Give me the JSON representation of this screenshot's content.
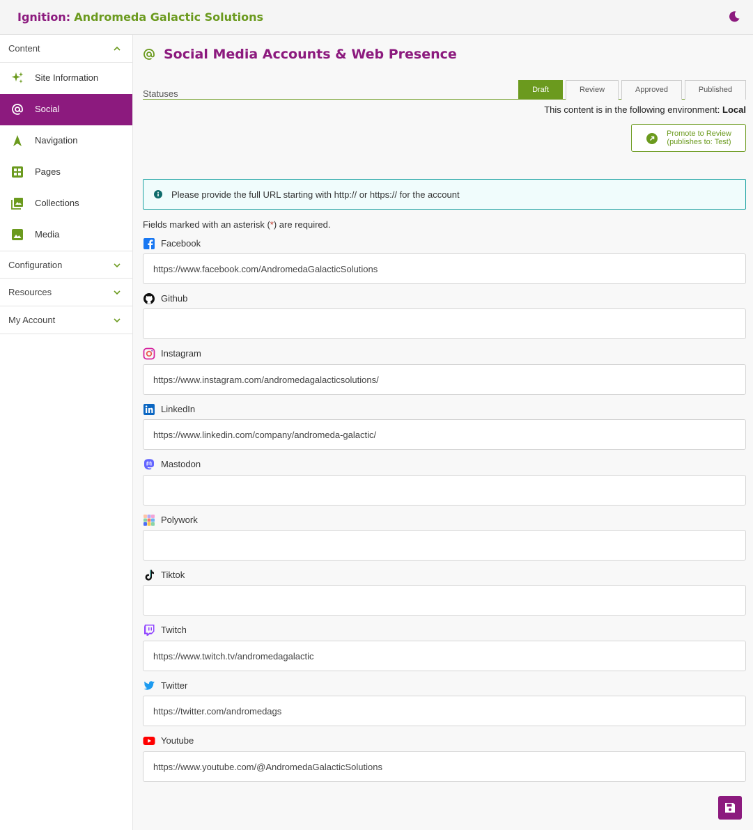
{
  "header": {
    "brand_prefix": "Ignition:",
    "brand_name": "Andromeda Galactic Solutions",
    "theme_icon": "moon-icon"
  },
  "sidebar": {
    "content_label": "Content",
    "items": [
      {
        "label": "Site Information",
        "icon": "sparkles-icon"
      },
      {
        "label": "Social",
        "icon": "at-icon"
      },
      {
        "label": "Navigation",
        "icon": "navigation-arrow-icon"
      },
      {
        "label": "Pages",
        "icon": "pages-icon"
      },
      {
        "label": "Collections",
        "icon": "collections-icon"
      },
      {
        "label": "Media",
        "icon": "image-icon"
      }
    ],
    "sections": [
      {
        "label": "Configuration"
      },
      {
        "label": "Resources"
      },
      {
        "label": "My Account"
      }
    ]
  },
  "main": {
    "title": "Social Media Accounts & Web Presence",
    "statuses_label": "Statuses",
    "tabs": [
      {
        "label": "Draft"
      },
      {
        "label": "Review"
      },
      {
        "label": "Approved"
      },
      {
        "label": "Published"
      }
    ],
    "env_prefix": "This content is in the following environment:",
    "env_value": "Local",
    "promote_line1": "Promote to Review",
    "promote_line2": "(publishes to: Test)",
    "info_text": "Please provide the full URL starting with http:// or https:// for the account",
    "required_pre": "Fields marked with an asterisk (",
    "required_ast": "*",
    "required_post": ") are required.",
    "fields": [
      {
        "label": "Facebook",
        "icon": "facebook-icon",
        "value": "https://www.facebook.com/AndromedaGalacticSolutions"
      },
      {
        "label": "Github",
        "icon": "github-icon",
        "value": ""
      },
      {
        "label": "Instagram",
        "icon": "instagram-icon",
        "value": "https://www.instagram.com/andromedagalacticsolutions/"
      },
      {
        "label": "LinkedIn",
        "icon": "linkedin-icon",
        "value": "https://www.linkedin.com/company/andromeda-galactic/"
      },
      {
        "label": "Mastodon",
        "icon": "mastodon-icon",
        "value": ""
      },
      {
        "label": "Polywork",
        "icon": "polywork-icon",
        "value": ""
      },
      {
        "label": "Tiktok",
        "icon": "tiktok-icon",
        "value": ""
      },
      {
        "label": "Twitch",
        "icon": "twitch-icon",
        "value": "https://www.twitch.tv/andromedagalactic"
      },
      {
        "label": "Twitter",
        "icon": "twitter-icon",
        "value": "https://twitter.com/andromedags"
      },
      {
        "label": "Youtube",
        "icon": "youtube-icon",
        "value": "https://www.youtube.com/@AndromedaGalacticSolutions"
      }
    ],
    "save_icon": "save-icon"
  },
  "colors": {
    "primary": "#8c1a7e",
    "accent": "#6b9a1e",
    "info": "#19a1a1"
  }
}
